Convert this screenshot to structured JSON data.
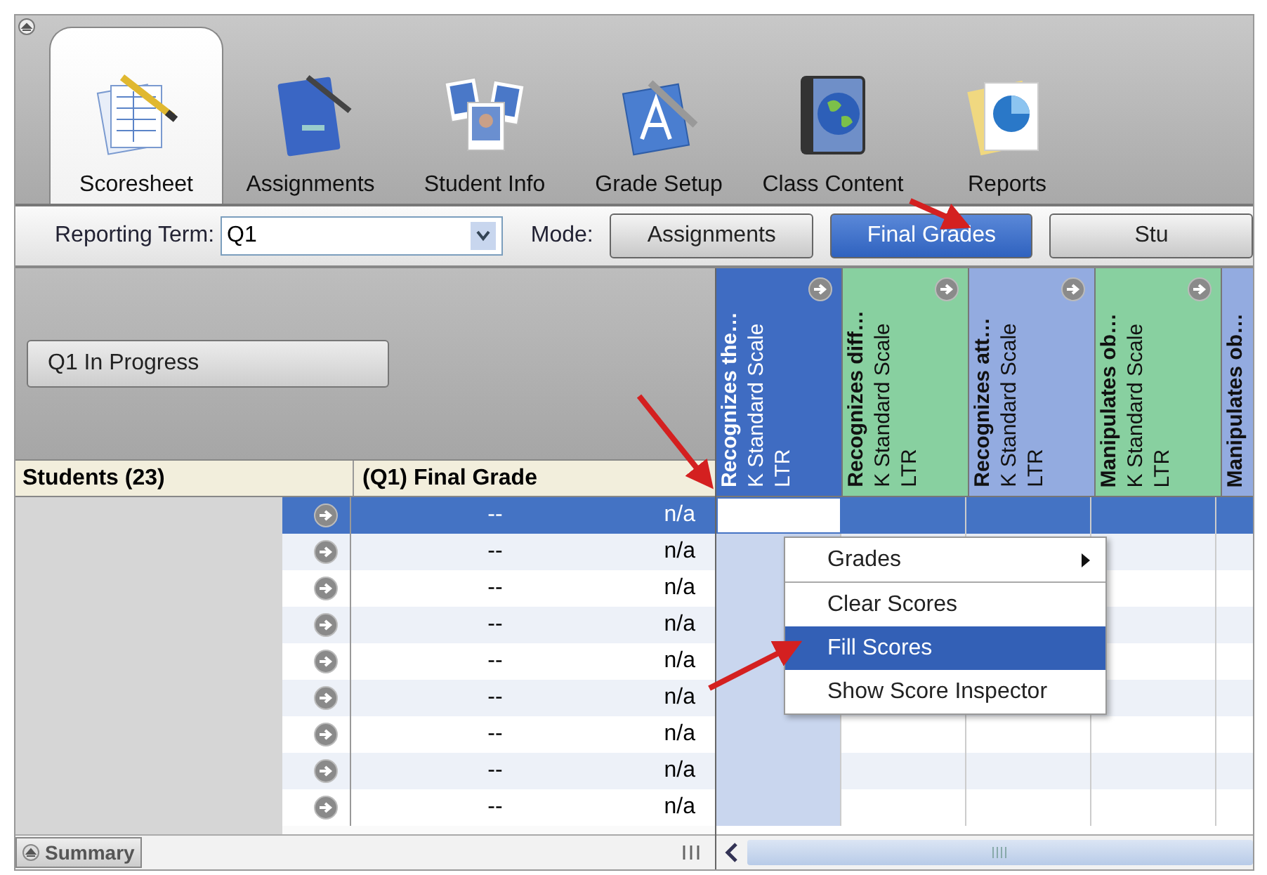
{
  "tabs": [
    {
      "label": "Scoresheet",
      "selected": true
    },
    {
      "label": "Assignments",
      "selected": false
    },
    {
      "label": "Student Info",
      "selected": false
    },
    {
      "label": "Grade Setup",
      "selected": false
    },
    {
      "label": "Class Content",
      "selected": false
    },
    {
      "label": "Reports",
      "selected": false
    }
  ],
  "toolbar": {
    "reporting_term_label": "Reporting Term:",
    "reporting_term": "Q1",
    "mode_label": "Mode:",
    "modes": [
      {
        "label": "Assignments",
        "selected": false
      },
      {
        "label": "Final Grades",
        "selected": true
      },
      {
        "label": "Stu",
        "selected": false
      }
    ]
  },
  "status_button": "Q1 In Progress",
  "students_header": "Students (23)",
  "final_grade_header": "(Q1) Final Grade",
  "rows": [
    {
      "grade": "--",
      "letter": "n/a",
      "selected": true
    },
    {
      "grade": "--",
      "letter": "n/a",
      "selected": false
    },
    {
      "grade": "--",
      "letter": "n/a",
      "selected": false
    },
    {
      "grade": "--",
      "letter": "n/a",
      "selected": false
    },
    {
      "grade": "--",
      "letter": "n/a",
      "selected": false
    },
    {
      "grade": "--",
      "letter": "n/a",
      "selected": false
    },
    {
      "grade": "--",
      "letter": "n/a",
      "selected": false
    },
    {
      "grade": "--",
      "letter": "n/a",
      "selected": false
    },
    {
      "grade": "--",
      "letter": "n/a",
      "selected": false
    }
  ],
  "standards": [
    {
      "title": "Recognizes the…",
      "scale": "K Standard Scale",
      "code": "LTR",
      "color": "#3f6cc2",
      "selected": true
    },
    {
      "title": "Recognizes diff…",
      "scale": "K Standard Scale",
      "code": "LTR",
      "color": "#88d0a0",
      "selected": false
    },
    {
      "title": "Recognizes att…",
      "scale": "K Standard Scale",
      "code": "LTR",
      "color": "#93abe0",
      "selected": false
    },
    {
      "title": "Manipulates ob…",
      "scale": "K Standard Scale",
      "code": "LTR",
      "color": "#88d0a0",
      "selected": false
    },
    {
      "title": "Manipulates ob…",
      "color": "#93abe0",
      "selected": false
    }
  ],
  "context_menu": [
    {
      "label": "Grades",
      "submenu": true,
      "selected": false
    },
    {
      "label": "Clear Scores",
      "submenu": false,
      "selected": false
    },
    {
      "label": "Fill Scores",
      "submenu": false,
      "selected": true
    },
    {
      "label": "Show Score Inspector",
      "submenu": false,
      "selected": false
    }
  ],
  "summary_button": "Summary"
}
